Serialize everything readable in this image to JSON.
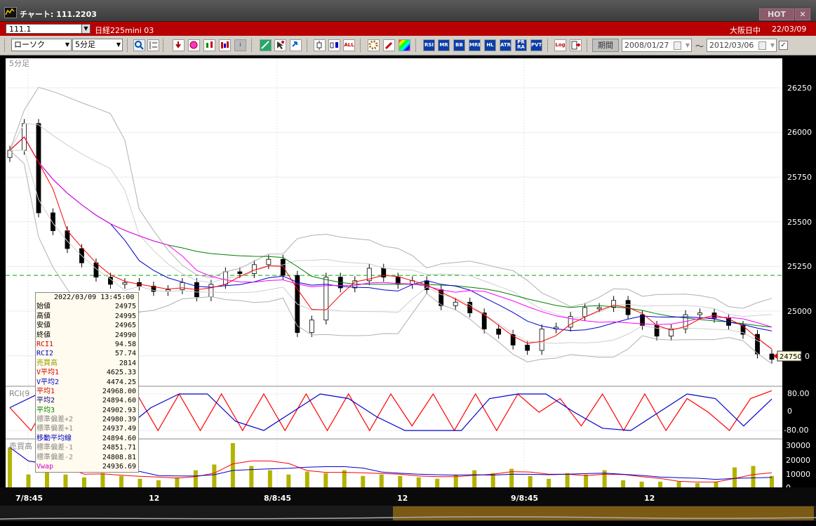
{
  "window": {
    "title": "チャート: 111.2203",
    "hot_label": "HOT",
    "close_glyph": "✕"
  },
  "symbol_bar": {
    "code": "111.1",
    "name": "日経225mini 03",
    "market_state": "大阪日中",
    "date": "22/03/09"
  },
  "toolbar": {
    "chart_style": "ローソク",
    "interval": "5分足",
    "icon_labels": [
      "RSI",
      "MR",
      "BB",
      "MRE",
      "HL",
      "ATR",
      "PR RA",
      "PVT",
      "Log",
      "ALL"
    ],
    "period_label": "期間",
    "date_from": "2008/01/27",
    "tilde": "～",
    "date_to": "2012/03/06",
    "check_mark": "✓"
  },
  "chart": {
    "interval_label": "5分足",
    "price_ticks": [
      "26250",
      "26000",
      "25750",
      "25500",
      "25250",
      "25000"
    ],
    "last_price": "24750",
    "rci_label": "RCI(9",
    "rci_ticks": [
      "80.00",
      "0",
      "-80.00"
    ],
    "volume_label": "売買高",
    "volume_ticks": [
      "30000",
      "20000",
      "10000",
      "0"
    ],
    "x_labels": [
      "7/8:45",
      "12",
      "8/8:45",
      "12",
      "9/8:45",
      "12"
    ],
    "colors": {
      "up": "#ffffff",
      "down": "#000000",
      "ma_red": "#ff0000",
      "ma_blue": "#0000cc",
      "ma_green": "#008000",
      "vwap": "#ff00ff",
      "volume": "#b3b300",
      "ref_line": "#00aa00"
    }
  },
  "chart_data": [
    {
      "type": "candlestick",
      "title": "",
      "interval": "5分足",
      "x": [
        "7/8:45",
        "12",
        "8/8:45",
        "12",
        "9/8:45",
        "12"
      ],
      "ylim": [
        24700,
        26400
      ],
      "close": [
        25900,
        26050,
        25550,
        25450,
        25350,
        25270,
        25190,
        25150,
        25160,
        25140,
        25110,
        25120,
        25160,
        25080,
        25150,
        25220,
        25210,
        25260,
        25290,
        25200,
        24880,
        24950,
        25190,
        25130,
        25170,
        25240,
        25190,
        25150,
        25170,
        25120,
        25030,
        25050,
        24990,
        24900,
        24870,
        24810,
        24780,
        24900,
        24910,
        24970,
        25020,
        25020,
        25060,
        24980,
        24920,
        24860,
        24900,
        24980,
        24990,
        24960,
        24920,
        24870,
        24760,
        24730
      ],
      "reference_line": 25200
    },
    {
      "type": "line",
      "title": "",
      "ylabel": "RCI(9",
      "ylim": [
        -100,
        100
      ],
      "series": [
        {
          "name": "RCI1",
          "values": [
            20,
            -80,
            80,
            -80,
            80,
            -80,
            80,
            -80,
            80,
            -80,
            80,
            -80,
            80,
            -80,
            80,
            -80,
            80,
            -80,
            80,
            -60,
            80,
            -80,
            80,
            -80,
            80,
            0,
            60,
            -60,
            80,
            -80,
            80,
            -80,
            60,
            0,
            -80,
            60,
            94.58
          ]
        },
        {
          "name": "RCI2",
          "values": [
            20,
            80,
            80,
            -60,
            -80,
            20,
            80,
            80,
            -40,
            -80,
            0,
            80,
            60,
            -20,
            -80,
            -80,
            -80,
            60,
            80,
            80,
            0,
            -70,
            -80,
            0,
            80,
            60,
            -60,
            57.74
          ]
        }
      ]
    },
    {
      "type": "bar",
      "title": "",
      "ylabel": "売買高",
      "ylim": [
        0,
        35000
      ],
      "values": [
        28000,
        9000,
        12000,
        9000,
        7000,
        10000,
        8000,
        6000,
        5000,
        7000,
        12000,
        16000,
        31000,
        15000,
        12000,
        9000,
        11000,
        10000,
        12000,
        8000,
        9000,
        8000,
        7000,
        6000,
        9000,
        12000,
        10000,
        13000,
        8000,
        6000,
        10000,
        9000,
        12000,
        5000,
        4000,
        4000,
        4000,
        3000,
        4000,
        14000,
        15000,
        8000
      ]
    }
  ],
  "info_panel": {
    "header": "2022/03/09  13:45:00",
    "rows": [
      {
        "label": "始値",
        "value": "24975",
        "color": "#000000"
      },
      {
        "label": "高値",
        "value": "24995",
        "color": "#000000"
      },
      {
        "label": "安値",
        "value": "24965",
        "color": "#000000"
      },
      {
        "label": "終値",
        "value": "24990",
        "color": "#000000"
      },
      {
        "label": "RCI1",
        "value": "94.58",
        "color": "#cc0000"
      },
      {
        "label": "RCI2",
        "value": "57.74",
        "color": "#0000cc"
      },
      {
        "label": "売買高",
        "value": "2814",
        "color": "#999900"
      },
      {
        "label": "V平均1",
        "value": "4625.33",
        "color": "#cc0000"
      },
      {
        "label": "V平均2",
        "value": "4474.25",
        "color": "#0000cc"
      },
      {
        "label": "平均1",
        "value": "24968.00",
        "color": "#cc0000"
      },
      {
        "label": "平均2",
        "value": "24894.60",
        "color": "#000080"
      },
      {
        "label": "平均3",
        "value": "24902.93",
        "color": "#008000"
      },
      {
        "label": "標準偏差+2",
        "value": "24980.39",
        "color": "#888888"
      },
      {
        "label": "標準偏差+1",
        "value": "24937.49",
        "color": "#888888"
      },
      {
        "label": "移動平均線",
        "value": "24894.60",
        "color": "#0000cc"
      },
      {
        "label": "標準偏差-1",
        "value": "24851.71",
        "color": "#888888"
      },
      {
        "label": "標準偏差-2",
        "value": "24808.81",
        "color": "#888888"
      },
      {
        "label": "Vwap",
        "value": "24936.69",
        "color": "#cc00cc"
      }
    ]
  }
}
